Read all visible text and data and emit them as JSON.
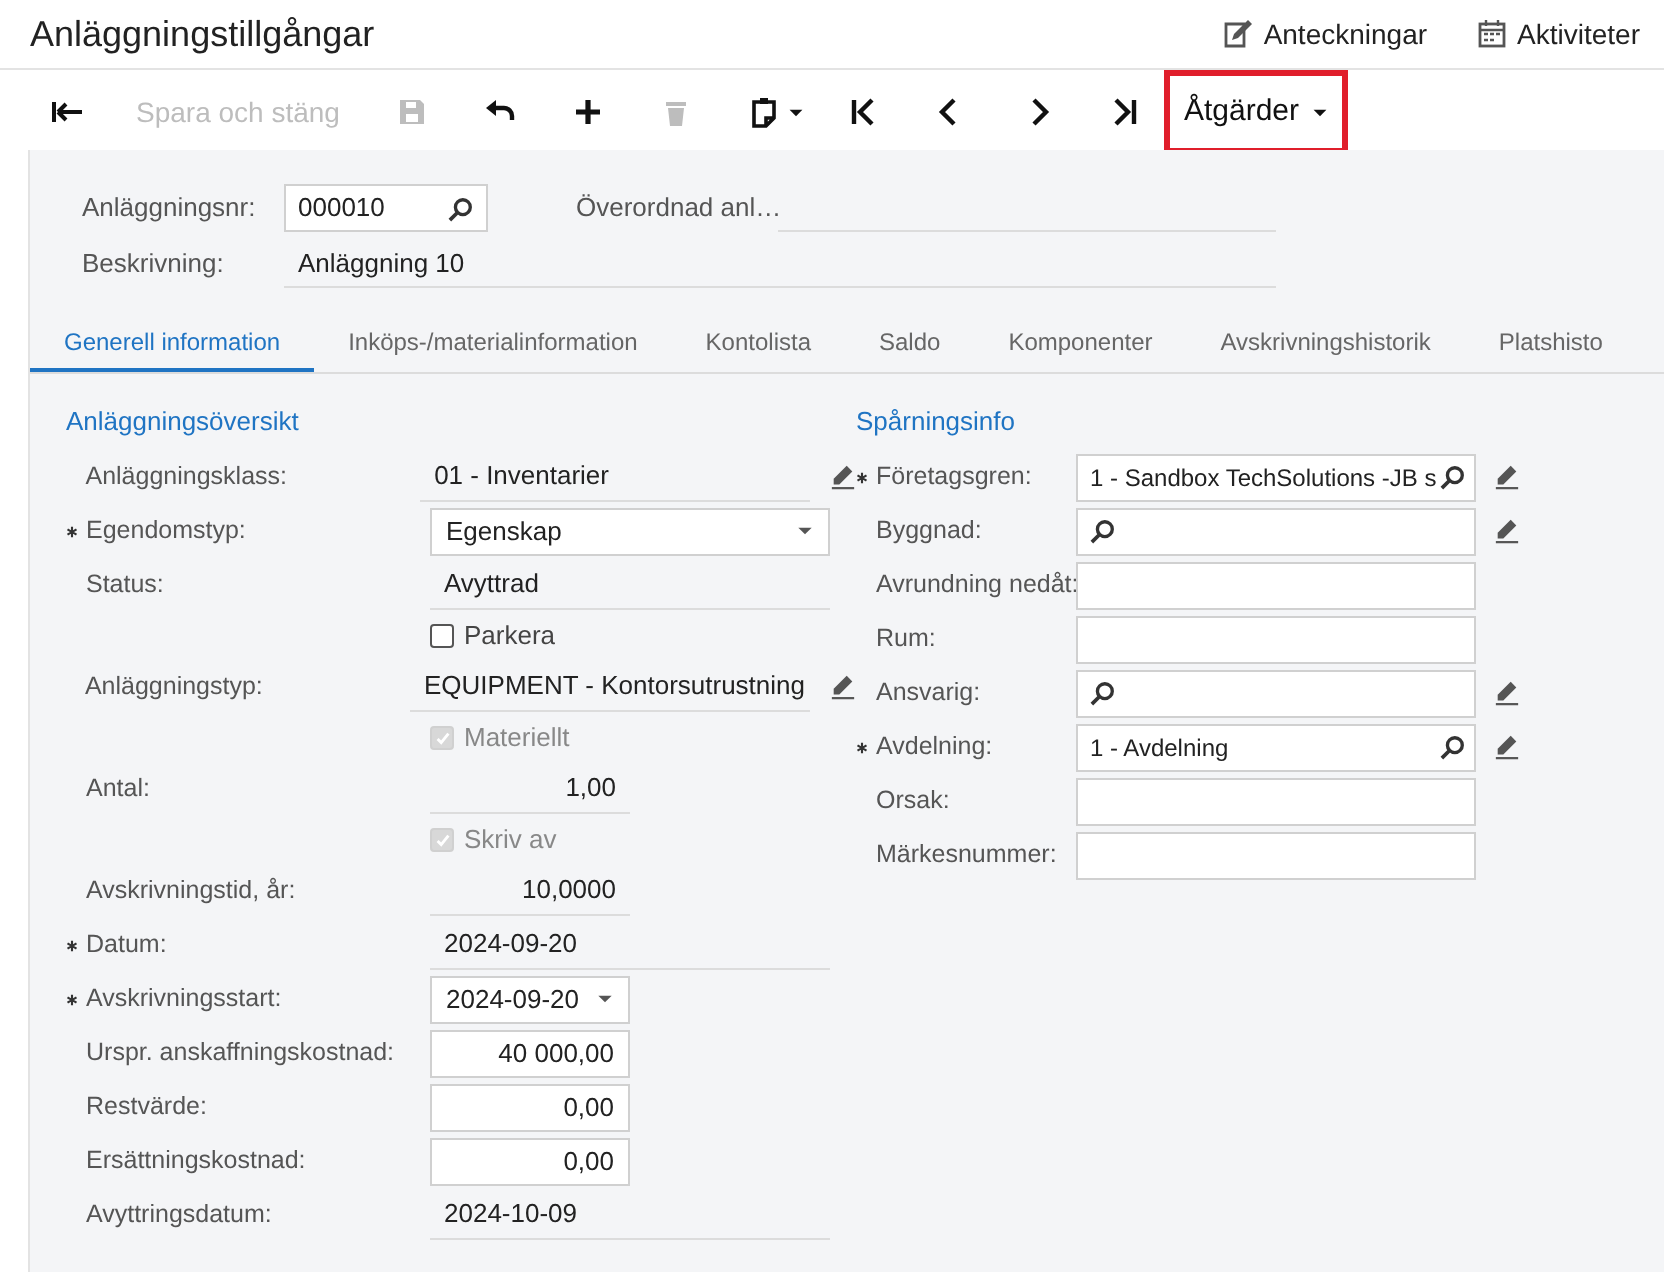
{
  "title": "Anläggningstillgångar",
  "header_links": [
    {
      "label": "Anteckningar"
    },
    {
      "label": "Aktiviteter"
    }
  ],
  "toolbar": [
    {
      "kind": "icon",
      "disabled": false
    },
    {
      "kind": "text",
      "label": "Spara och stäng",
      "disabled": true
    },
    {
      "kind": "icon",
      "disabled": true
    },
    {
      "kind": "icon",
      "disabled": false
    },
    {
      "kind": "icon",
      "disabled": false
    },
    {
      "kind": "icon",
      "disabled": true
    },
    {
      "kind": "icon",
      "disabled": false
    },
    {
      "kind": "icon",
      "disabled": false
    },
    {
      "kind": "icon",
      "disabled": false
    },
    {
      "kind": "icon",
      "disabled": false
    },
    {
      "kind": "icon",
      "disabled": false
    },
    {
      "kind": "menu",
      "label": "Åtgärder",
      "disabled": false,
      "highlighted": true
    }
  ],
  "header": {
    "asset_no": {
      "label": "Anläggningsnr:",
      "value": "000010"
    },
    "parent": {
      "label": "Överordnad anl…"
    },
    "description": {
      "label": "Beskrivning:",
      "value": "Anläggning 10"
    }
  },
  "tabs": [
    {
      "label": "Generell information",
      "selected": true
    },
    {
      "label": "Inköps-/materialinformation",
      "selected": false
    },
    {
      "label": "Kontolista",
      "selected": false
    },
    {
      "label": "Saldo",
      "selected": false
    },
    {
      "label": "Komponenter",
      "selected": false
    },
    {
      "label": "Avskrivningshistorik",
      "selected": false
    },
    {
      "label": "Platshisto",
      "selected": false
    }
  ],
  "sections": [
    {
      "title": "Anläggningsöversikt",
      "fields": [
        {
          "kind": "display",
          "label": "Anläggningsklass:",
          "value": "01 - Inventarier",
          "required": false,
          "edit": true
        },
        {
          "kind": "select",
          "label": "Egendomstyp:",
          "value": "Egenskap",
          "required": true,
          "edit": false
        },
        {
          "kind": "display",
          "label": "Status:",
          "value": "Avyttrad",
          "required": false,
          "edit": false
        },
        {
          "kind": "checkbox",
          "label": "Parkera",
          "checked": false,
          "disabled": false
        },
        {
          "kind": "display",
          "label": "Anläggningstyp:",
          "value": "EQUIPMENT - Kontorsutrustning",
          "required": false,
          "edit": true
        },
        {
          "kind": "checkbox",
          "label": "Materiellt",
          "checked": true,
          "disabled": true
        },
        {
          "kind": "number",
          "label": "Antal:",
          "value": "1,00",
          "required": false,
          "edit": false
        },
        {
          "kind": "checkbox",
          "label": "Skriv av",
          "checked": true,
          "disabled": true
        },
        {
          "kind": "number",
          "label": "Avskrivningstid, år:",
          "value": "10,0000",
          "required": false,
          "edit": false
        },
        {
          "kind": "display",
          "label": "Datum:",
          "value": "2024-09-20",
          "required": true,
          "edit": false
        },
        {
          "kind": "date",
          "label": "Avskrivningsstart:",
          "value": "2024-09-20",
          "required": true,
          "edit": false
        },
        {
          "kind": "money",
          "label": "Urspr. anskaffningskostnad:",
          "value": "40 000,00",
          "required": false,
          "edit": false
        },
        {
          "kind": "money",
          "label": "Restvärde:",
          "value": "0,00",
          "required": false,
          "edit": false
        },
        {
          "kind": "money",
          "label": "Ersättningskostnad:",
          "value": "0,00",
          "required": false,
          "edit": false
        },
        {
          "kind": "display",
          "label": "Avyttringsdatum:",
          "value": "2024-10-09",
          "required": false,
          "edit": false
        }
      ]
    },
    {
      "title": "Spårningsinfo",
      "fields": [
        {
          "kind": "lookup",
          "label": "Företagsgren:",
          "value": "1 - Sandbox TechSolutions -JB s",
          "required": true,
          "edit": true
        },
        {
          "kind": "lookup",
          "label": "Byggnad:",
          "required": false,
          "edit": true
        },
        {
          "kind": "input",
          "label": "Avrundning nedåt:",
          "required": false,
          "edit": false
        },
        {
          "kind": "input",
          "label": "Rum:",
          "required": false,
          "edit": false
        },
        {
          "kind": "lookup",
          "label": "Ansvarig:",
          "required": false,
          "edit": true
        },
        {
          "kind": "lookup",
          "label": "Avdelning:",
          "value": "1 - Avdelning",
          "required": true,
          "edit": true
        },
        {
          "kind": "input",
          "label": "Orsak:",
          "required": false,
          "edit": false
        },
        {
          "kind": "input",
          "label": "Märkesnummer:",
          "required": false,
          "edit": false
        }
      ]
    }
  ]
}
